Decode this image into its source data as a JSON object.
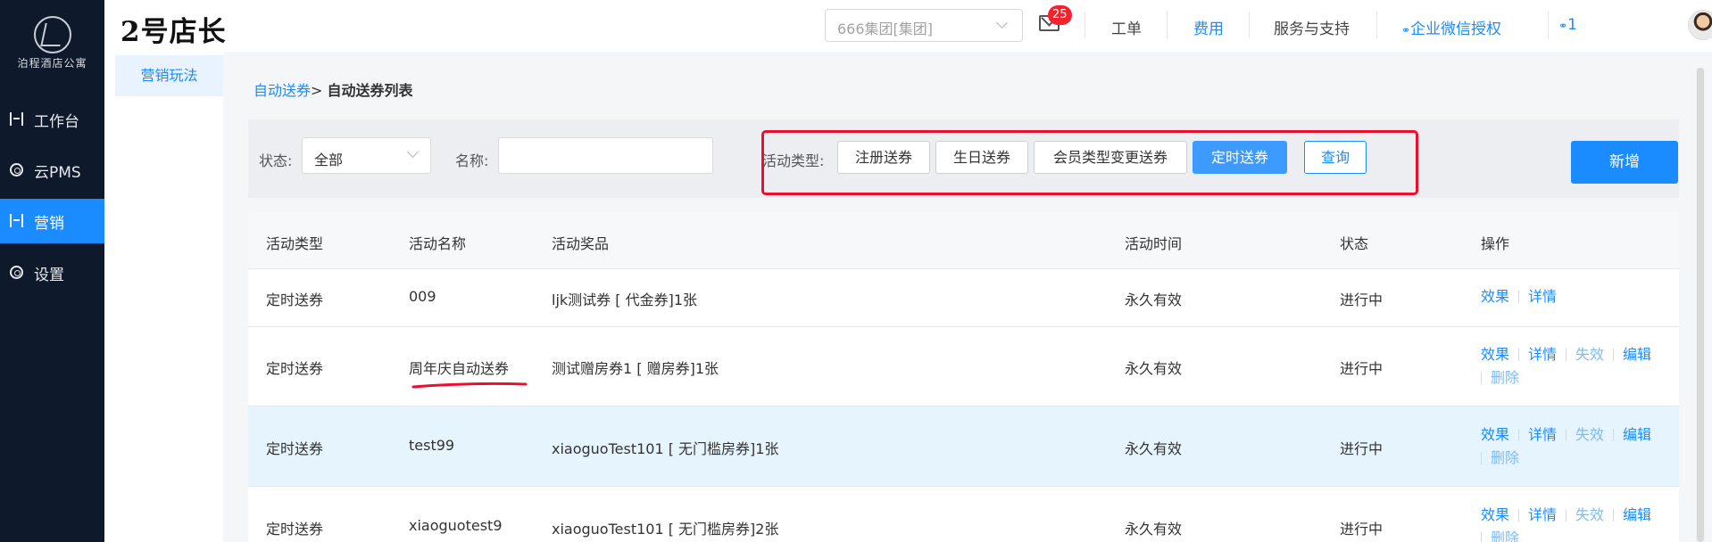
{
  "sidebar": {
    "brand": "泊程酒店公寓",
    "items": [
      {
        "label": "工作台",
        "icon": "workbench-icon"
      },
      {
        "label": "云PMS",
        "icon": "gear-icon"
      },
      {
        "label": "营销",
        "icon": "marketing-icon",
        "active": true
      },
      {
        "label": "设置",
        "icon": "gear-icon"
      }
    ]
  },
  "header": {
    "title": "2号店长",
    "group_value": "666集团[集团]",
    "mail_badge": "25",
    "links": [
      "工单",
      "费用",
      "服务与支持",
      "企业微信授权"
    ],
    "user_count": "1"
  },
  "submenu": {
    "item": "营销玩法"
  },
  "breadcrumb": {
    "parent": "自动送券",
    "sep": ">",
    "current": "自动送券列表"
  },
  "filter": {
    "status_label": "状态:",
    "status_value": "全部",
    "name_label": "名称:",
    "name_value": "",
    "type_label": "活动类型:",
    "type_buttons": [
      "注册送券",
      "生日送券",
      "会员类型变更送券",
      "定时送券"
    ],
    "query_label": "查询",
    "add_label": "新增"
  },
  "table": {
    "columns": [
      "活动类型",
      "活动名称",
      "活动奖品",
      "活动时间",
      "状态",
      "操作"
    ],
    "rows": [
      {
        "type": "定时送券",
        "name": "009",
        "prize": "ljk测试券 [ 代金券]1张",
        "time": "永久有效",
        "status": "进行中"
      },
      {
        "type": "定时送券",
        "name": "周年庆自动送券",
        "prize": "测试赠房券1 [ 赠房券]1张",
        "time": "永久有效",
        "status": "进行中"
      },
      {
        "type": "定时送券",
        "name": "test99",
        "prize": "xiaoguoTest101 [ 无门槛房券]1张",
        "time": "永久有效",
        "status": "进行中"
      },
      {
        "type": "定时送券",
        "name": "xiaoguotest9",
        "prize": "xiaoguoTest101 [ 无门槛房券]2张",
        "time": "永久有效",
        "status": "进行中"
      }
    ],
    "ops": {
      "effect": "效果",
      "detail": "详情",
      "invalid": "失效",
      "edit": "编辑",
      "delete": "删除"
    }
  }
}
